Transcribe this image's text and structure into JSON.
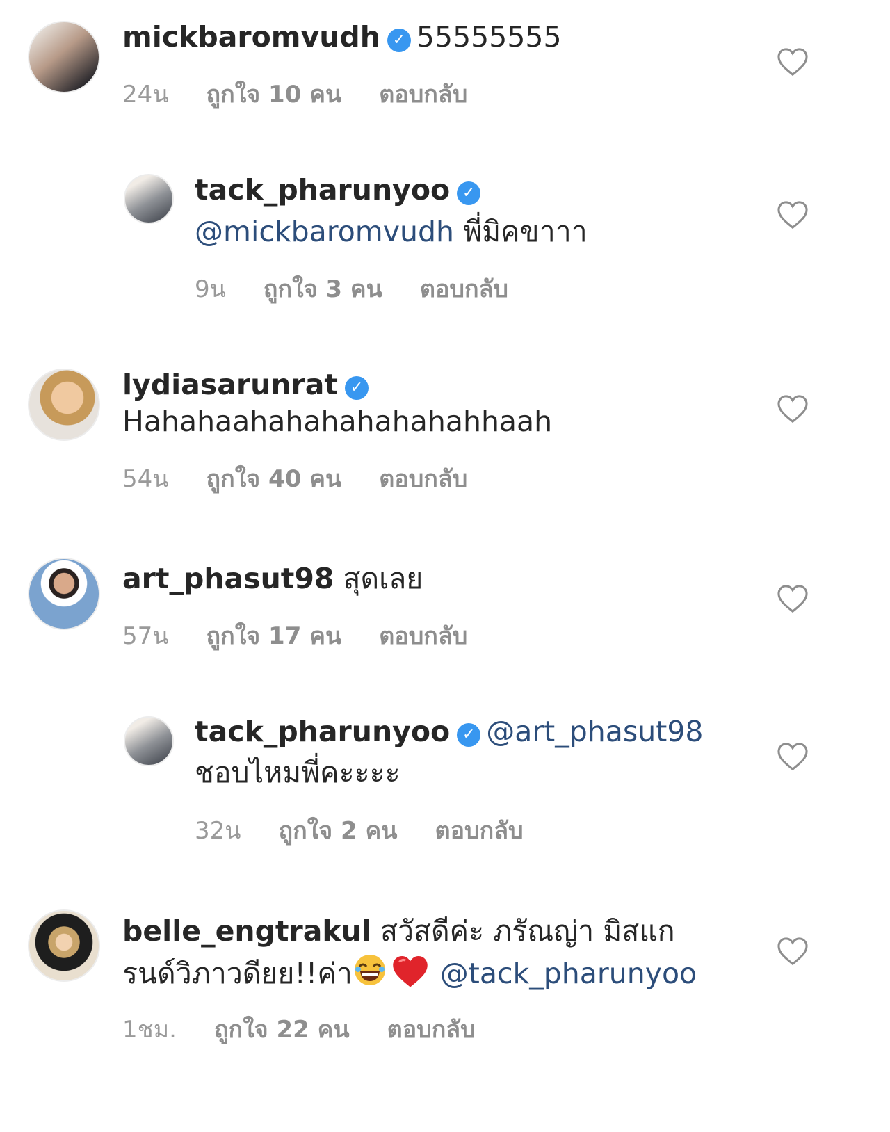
{
  "comments": [
    {
      "username": "mickbaromvudh",
      "text": "55555555",
      "time": "24น",
      "likes": "ถูกใจ 10 คน",
      "reply": "ตอบกลับ"
    },
    {
      "username": "tack_pharunyoo",
      "mention": "@mickbaromvudh",
      "text": "พี่มิคขาาา",
      "time": "9น",
      "likes": "ถูกใจ 3 คน",
      "reply": "ตอบกลับ"
    },
    {
      "username": "lydiasarunrat",
      "text": "Hahahaahahahahahahahhaah",
      "time": "54น",
      "likes": "ถูกใจ 40 คน",
      "reply": "ตอบกลับ"
    },
    {
      "username": "art_phasut98",
      "text": "สุดเลย",
      "time": "57น",
      "likes": "ถูกใจ 17 คน",
      "reply": "ตอบกลับ"
    },
    {
      "username": "tack_pharunyoo",
      "mention": "@art_phasut98",
      "text": "ชอบไหมพี่คะะะะ",
      "time": "32น",
      "likes": "ถูกใจ 2 คน",
      "reply": "ตอบกลับ"
    },
    {
      "username": "belle_engtrakul",
      "text_line1": "สวัสดีค่ะ ภรัณญ่า มิสแก",
      "text_line2": "รนด์วิภาวดียย!!ค่า",
      "mention": "@tack_pharunyoo",
      "time": "1ชม.",
      "likes": "ถูกใจ 22 คน",
      "reply": "ตอบกลับ"
    }
  ],
  "colors": {
    "verified_badge": "#3897f0",
    "mention": "#2c4d7a",
    "meta": "#9a9a9a"
  },
  "icons": [
    "verified-badge-icon",
    "heart-outline-icon",
    "laughing-emoji-icon",
    "red-heart-emoji-icon"
  ]
}
